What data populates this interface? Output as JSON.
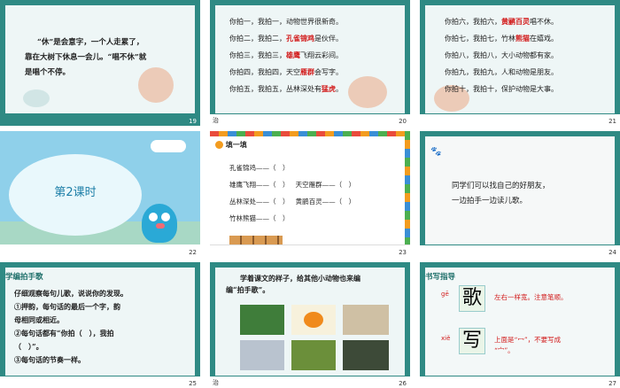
{
  "slide19": {
    "lines": [
      "“休”是会意字，一个人走累了，",
      "靠在大树下休息一会儿。“唱不休”就",
      "是唱个不停。"
    ],
    "page": "19"
  },
  "slide20": {
    "rows": [
      {
        "pre": "你拍一，我拍一，",
        "hl": "",
        "post": "动物世界很新奇。"
      },
      {
        "pre": "你拍二，我拍二，",
        "hl": "孔雀锦鸡",
        "post": "是伙伴。"
      },
      {
        "pre": "你拍三，我拍三，",
        "hl": "雄鹰",
        "post": "飞翔云彩间。"
      },
      {
        "pre": "你拍四，我拍四，天空",
        "hl": "雁群",
        "post": "会写字。"
      },
      {
        "pre": "你拍五，我拍五，丛林深处有",
        "hl": "猛虎",
        "post": "。"
      }
    ],
    "page": "20",
    "corner": "治"
  },
  "slide21": {
    "rows": [
      {
        "pre": "你拍六，我拍六，",
        "hl": "黄鹂百灵",
        "post": "唱不休。"
      },
      {
        "pre": "你拍七，我拍七，竹林",
        "hl": "熊猫",
        "post": "在嬉戏。"
      },
      {
        "pre": "你拍八，我拍八，大小动物都有家。",
        "hl": "",
        "post": ""
      },
      {
        "pre": "你拍九，我拍九，人和动物是朋友。",
        "hl": "",
        "post": ""
      },
      {
        "pre": "你拍十，我拍十，保护动物是大事。",
        "hl": "",
        "post": ""
      }
    ],
    "page": "21"
  },
  "slide22": {
    "title": "第2课时",
    "page": "22"
  },
  "slide23": {
    "heading": "填一填",
    "rows": [
      [
        "孔雀锦鸡——（　）",
        ""
      ],
      [
        "雄鹰飞翔——（　）",
        "天空雁群——（　）"
      ],
      [
        "丛林深处——（　）",
        "黄鹂百灵——（　）"
      ],
      [
        "竹林熊猫——（　）",
        ""
      ]
    ],
    "page": "23"
  },
  "slide24": {
    "lines": [
      "同学们可以找自己的好朋友，",
      "一边拍手一边读儿歌。"
    ],
    "page": "24"
  },
  "slide25": {
    "heading": "学编拍手歌",
    "lines": [
      "仔细观察每句儿歌，说说你的发现。",
      "①押韵，每句话的最后一个字，韵",
      "母相同或相近。",
      "②每句话都有“你拍（　），我拍",
      "（　）”。",
      "③每句话的节奏一样。"
    ],
    "page": "25"
  },
  "slide26": {
    "lines": [
      "学着课文的样子，给其他小动物也来编",
      "编“拍手歌”。"
    ],
    "page": "26",
    "corner": "治"
  },
  "slide27": {
    "heading": "书写指导",
    "chars": [
      {
        "pinyin": "gē",
        "char": "歌"
      },
      {
        "pinyin": "xiě",
        "char": "写"
      }
    ],
    "notes": [
      "左右一样宽。注意笔顺。",
      "上面是“冖”，不要写成",
      "“宀”。"
    ],
    "page": "27"
  },
  "colors": {
    "teal": "#2f8a84",
    "red": "#d21c1c",
    "orange": "#f39c1f",
    "green": "#4caf50"
  }
}
